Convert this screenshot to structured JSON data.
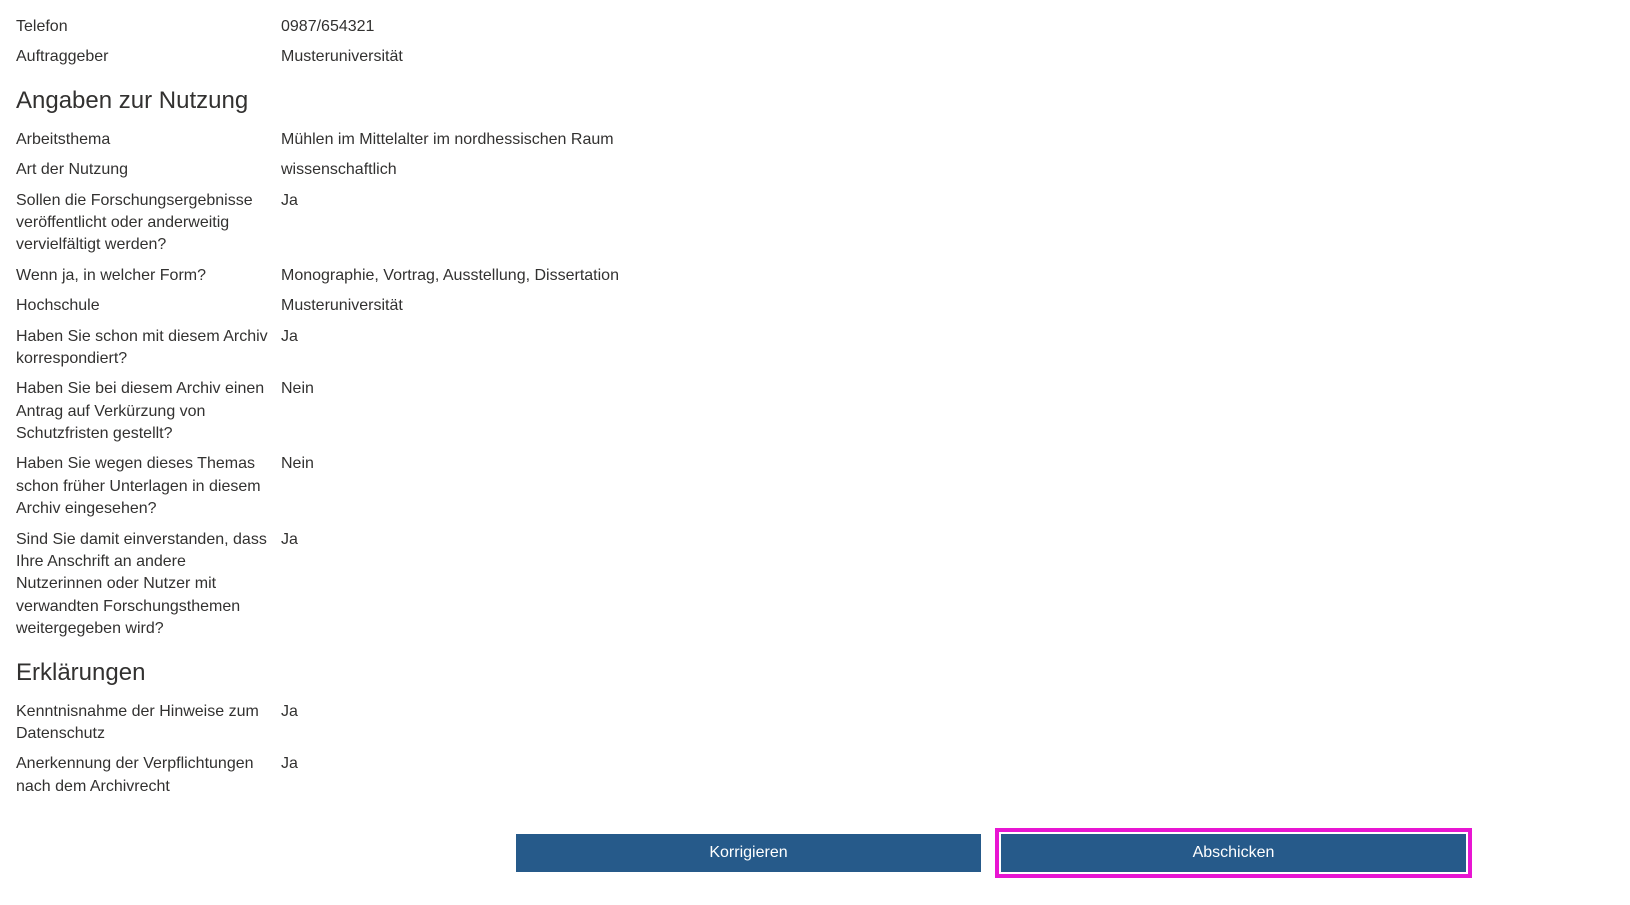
{
  "contact": {
    "telefon_label": "Telefon",
    "telefon_value": "0987/654321",
    "auftraggeber_label": "Auftraggeber",
    "auftraggeber_value": "Musteruniversität"
  },
  "nutzung": {
    "heading": "Angaben zur Nutzung",
    "arbeitsthema_label": "Arbeitsthema",
    "arbeitsthema_value": "Mühlen im Mittelalter im nordhessischen Raum",
    "art_label": "Art der Nutzung",
    "art_value": "wissenschaftlich",
    "veroeffentlichen_label": "Sollen die Forschungsergebnisse veröffentlicht oder anderweitig vervielfältigt werden?",
    "veroeffentlichen_value": "Ja",
    "form_label": "Wenn ja, in welcher Form?",
    "form_value": "Monographie, Vortrag, Ausstellung, Dissertation",
    "hochschule_label": "Hochschule",
    "hochschule_value": "Musteruniversität",
    "korrespondiert_label": "Haben Sie schon mit diesem Archiv korrespondiert?",
    "korrespondiert_value": "Ja",
    "schutzfristen_label": "Haben Sie bei diesem Archiv einen Antrag auf Verkürzung von Schutzfristen gestellt?",
    "schutzfristen_value": "Nein",
    "frueher_label": "Haben Sie wegen dieses Themas schon früher Unterlagen in diesem Archiv eingesehen?",
    "frueher_value": "Nein",
    "weitergabe_label": "Sind Sie damit einverstanden, dass Ihre Anschrift an andere Nutzerinnen oder Nutzer mit verwandten Forschungsthemen weitergegeben wird?",
    "weitergabe_value": "Ja"
  },
  "erklaerungen": {
    "heading": "Erklärungen",
    "datenschutz_label": "Kenntnisnahme der Hinweise zum Datenschutz",
    "datenschutz_value": "Ja",
    "archivrecht_label": "Anerkennung der Verpflichtungen nach dem Archivrecht",
    "archivrecht_value": "Ja"
  },
  "buttons": {
    "korrigieren": "Korrigieren",
    "abschicken": "Abschicken"
  }
}
